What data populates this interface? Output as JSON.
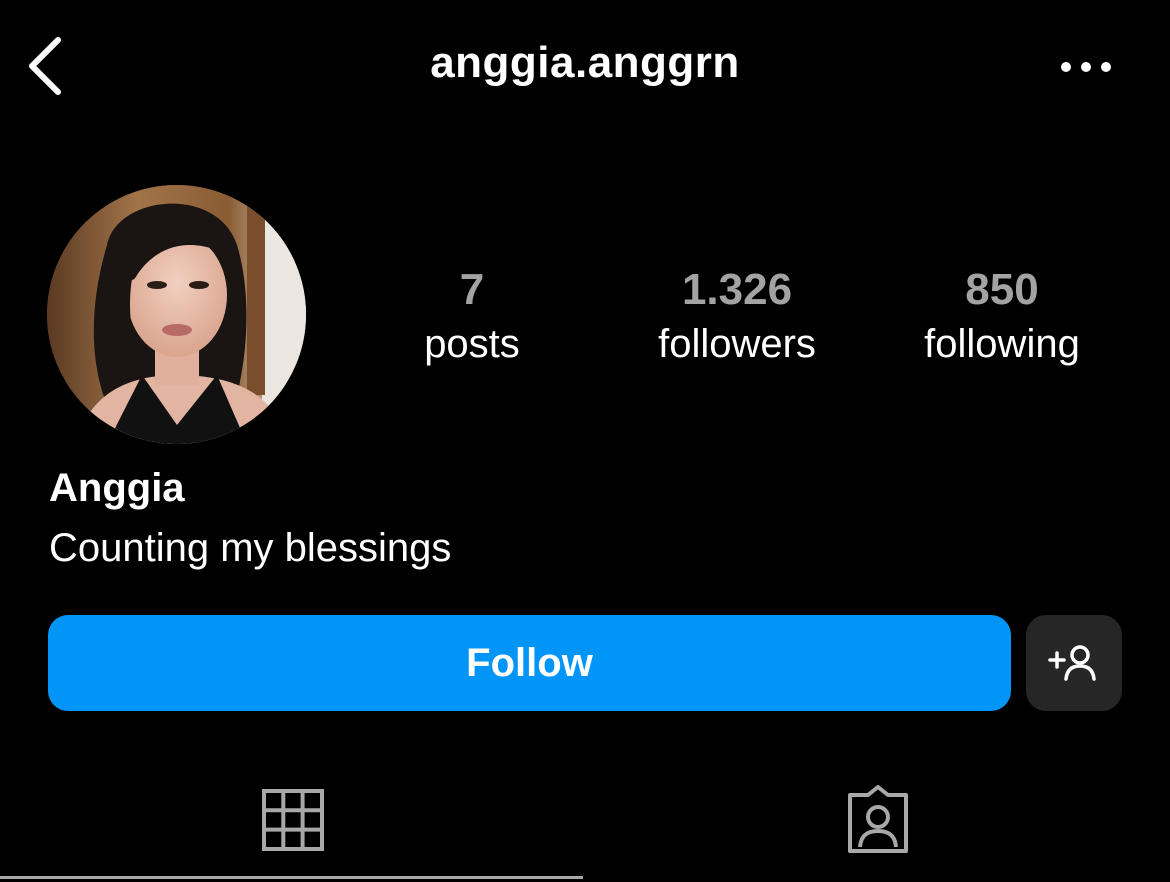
{
  "header": {
    "username": "anggia.anggrn",
    "back_icon": "chevron-left-icon",
    "more_icon": "more-horizontal-icon"
  },
  "profile": {
    "avatar_description": "profile photo",
    "stats": [
      {
        "value": "7",
        "label": "posts"
      },
      {
        "value": "1.326",
        "label": "followers"
      },
      {
        "value": "850",
        "label": "following"
      }
    ],
    "display_name": "Anggia",
    "bio": "Counting my blessings"
  },
  "actions": {
    "follow_label": "Follow",
    "follow_color": "#0095f6",
    "suggest_icon": "add-person-icon"
  },
  "tabs": [
    {
      "icon": "grid-icon",
      "active": true
    },
    {
      "icon": "tagged-person-icon",
      "active": false
    }
  ],
  "colors": {
    "background": "#000000",
    "stat_value": "#a3a3a3",
    "secondary_button": "#262626"
  }
}
